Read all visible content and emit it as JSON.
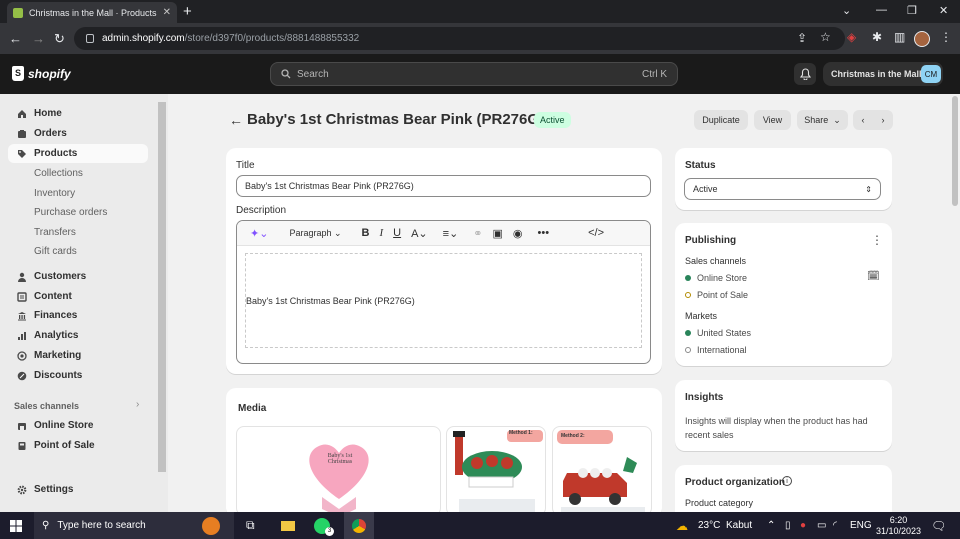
{
  "browser": {
    "tab_title": "Christmas in the Mall · Products",
    "url_domain": "admin.shopify.com",
    "url_path": "/store/d397f0/products/8881488855332"
  },
  "header": {
    "logo_text": "shopify",
    "search_placeholder": "Search",
    "search_shortcut": "Ctrl K",
    "store_name": "Christmas in the Mall",
    "store_initials": "CM"
  },
  "sidebar": {
    "items": [
      {
        "label": "Home",
        "icon": "home-icon"
      },
      {
        "label": "Orders",
        "icon": "orders-icon"
      },
      {
        "label": "Products",
        "icon": "tag-icon",
        "active": true
      }
    ],
    "product_sub": [
      "Collections",
      "Inventory",
      "Purchase orders",
      "Transfers",
      "Gift cards"
    ],
    "items2": [
      {
        "label": "Customers",
        "icon": "person-icon"
      },
      {
        "label": "Content",
        "icon": "content-icon"
      },
      {
        "label": "Finances",
        "icon": "bank-icon"
      },
      {
        "label": "Analytics",
        "icon": "chart-icon"
      },
      {
        "label": "Marketing",
        "icon": "target-icon"
      },
      {
        "label": "Discounts",
        "icon": "discount-icon"
      }
    ],
    "sales_channels_label": "Sales channels",
    "channels": [
      {
        "label": "Online Store",
        "icon": "store-icon"
      },
      {
        "label": "Point of Sale",
        "icon": "pos-icon"
      }
    ],
    "settings_label": "Settings"
  },
  "product": {
    "title": "Baby's 1st Christmas Bear Pink (PR276G)",
    "status_badge": "Active",
    "actions": {
      "duplicate": "Duplicate",
      "view": "View",
      "share": "Share"
    }
  },
  "form": {
    "title_label": "Title",
    "title_value": "Baby's 1st Christmas Bear Pink (PR276G)",
    "description_label": "Description",
    "paragraph_label": "Paragraph",
    "description_text": "Baby's 1st Christmas Bear Pink (PR276G)",
    "media_label": "Media"
  },
  "status_card": {
    "heading": "Status",
    "value": "Active"
  },
  "publishing": {
    "heading": "Publishing",
    "sales_channels_label": "Sales channels",
    "channels": [
      {
        "label": "Online Store",
        "state": "on"
      },
      {
        "label": "Point of Sale",
        "state": "off"
      }
    ],
    "markets_label": "Markets",
    "markets": [
      {
        "label": "United States",
        "state": "on"
      },
      {
        "label": "International",
        "state": "off"
      }
    ]
  },
  "insights": {
    "heading": "Insights",
    "text": "Insights will display when the product has had recent sales"
  },
  "organization": {
    "heading": "Product organization",
    "category_label": "Product category"
  },
  "media_text": {
    "heart_text": "Baby's 1st Christmas",
    "img2_label": "Method 1:",
    "img3_label": "Method 2:"
  },
  "taskbar": {
    "search_placeholder": "Type here to search",
    "weather_temp": "23°C",
    "weather_desc": "Kabut",
    "lang": "ENG",
    "time": "6:20",
    "date": "31/10/2023",
    "whatsapp_count": "3"
  },
  "colors": {
    "accent_green": "#29845a",
    "badge_bg": "#cdfee1",
    "dark_header": "#1a1a1a"
  }
}
